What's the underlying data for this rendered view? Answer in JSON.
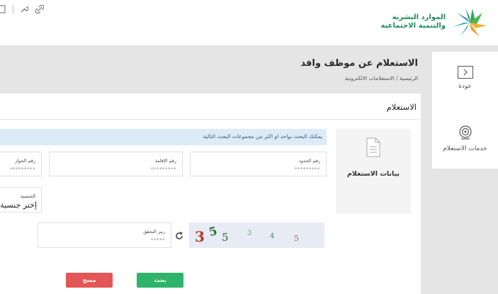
{
  "header": {
    "logo_line1": "الموارد البشرية",
    "logo_line2": "والتنمية الاجتماعية"
  },
  "sidenav": {
    "back_label": "عودة",
    "services_label": "خدمات الاستعلام"
  },
  "page": {
    "title": "الاستعلام عن موظف وافد",
    "breadcrumb": "الرئيسية / الاستعلامات الالكترونية"
  },
  "card": {
    "title": "الاستعلام",
    "data_tab_label": "بيانات الاستعلام",
    "notice": "يمكنك البحث بواحد او اكثر من مجموعات البحث التالية"
  },
  "fields": {
    "border_number": {
      "label": "رقم الحدود",
      "placeholder": "*********"
    },
    "iqama_number": {
      "label": "رقم الإقامة",
      "placeholder": "*********"
    },
    "passport_number": {
      "label": "رقم الجواز",
      "placeholder": "*********"
    },
    "nationality": {
      "label": "الجنسية",
      "value": "إختر جنسية"
    },
    "captcha_code": {
      "label": "رمز التحقق",
      "placeholder": "*****"
    }
  },
  "captcha": {
    "chars": [
      "3",
      "5",
      "5",
      "3",
      "4",
      "5"
    ]
  },
  "buttons": {
    "search": "بحث",
    "clear": "مسح"
  },
  "colors": {
    "brand_green": "#1f8a5b",
    "search_green": "#2db36b",
    "clear_red": "#e35656",
    "notice_blue": "#dcebf7"
  }
}
